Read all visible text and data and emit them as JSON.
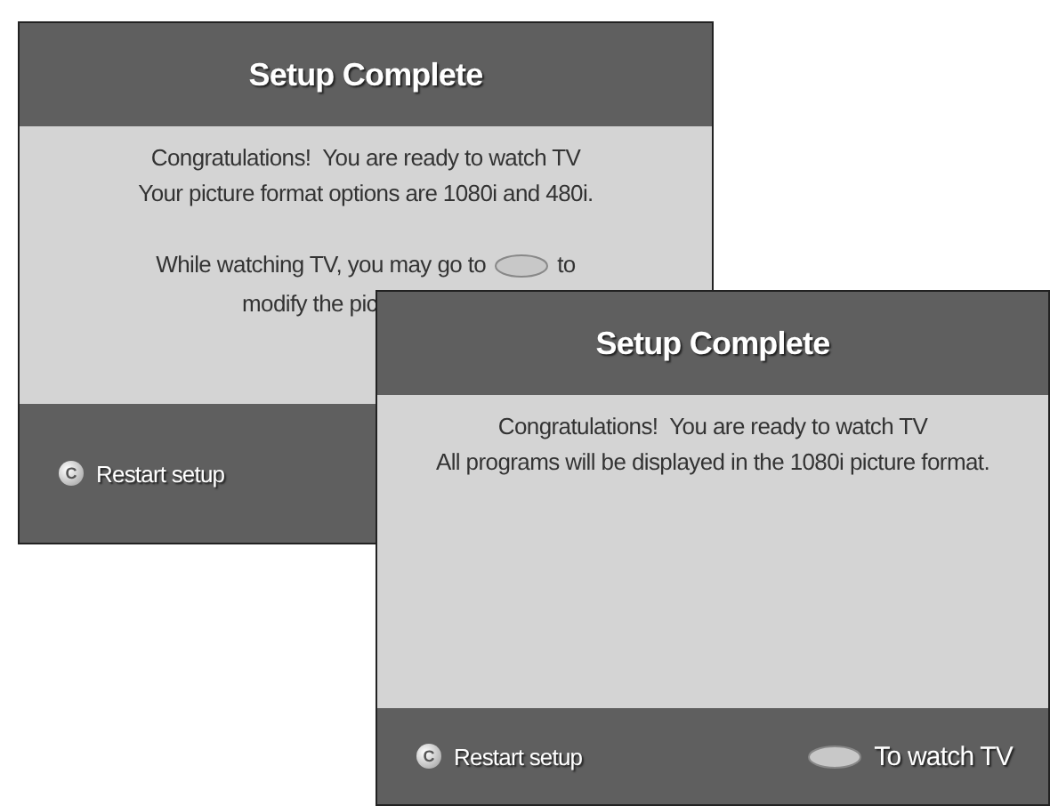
{
  "screens": [
    {
      "title": "Setup Complete",
      "lines": [
        {
          "kind": "text",
          "text": "Congratulations!  You are ready to watch TV"
        },
        {
          "kind": "text",
          "text": "Your picture format options are 1080i and 480i."
        },
        {
          "kind": "gap"
        },
        {
          "kind": "with_key",
          "text": "While watching TV, you may go to",
          "after": "to"
        },
        {
          "kind": "cut",
          "text": "modify the pic"
        }
      ],
      "actions": [
        {
          "kind": "round",
          "key": "C",
          "label": "Restart setup"
        }
      ]
    },
    {
      "title": "Setup Complete",
      "lines": [
        {
          "kind": "text",
          "text": "Congratulations!  You are ready to watch TV"
        },
        {
          "kind": "text",
          "text": "All programs will be displayed in the 1080i picture format."
        }
      ],
      "actions": [
        {
          "kind": "round",
          "key": "C",
          "label": "Restart setup"
        },
        {
          "kind": "oval",
          "label": "To watch TV"
        }
      ]
    }
  ]
}
